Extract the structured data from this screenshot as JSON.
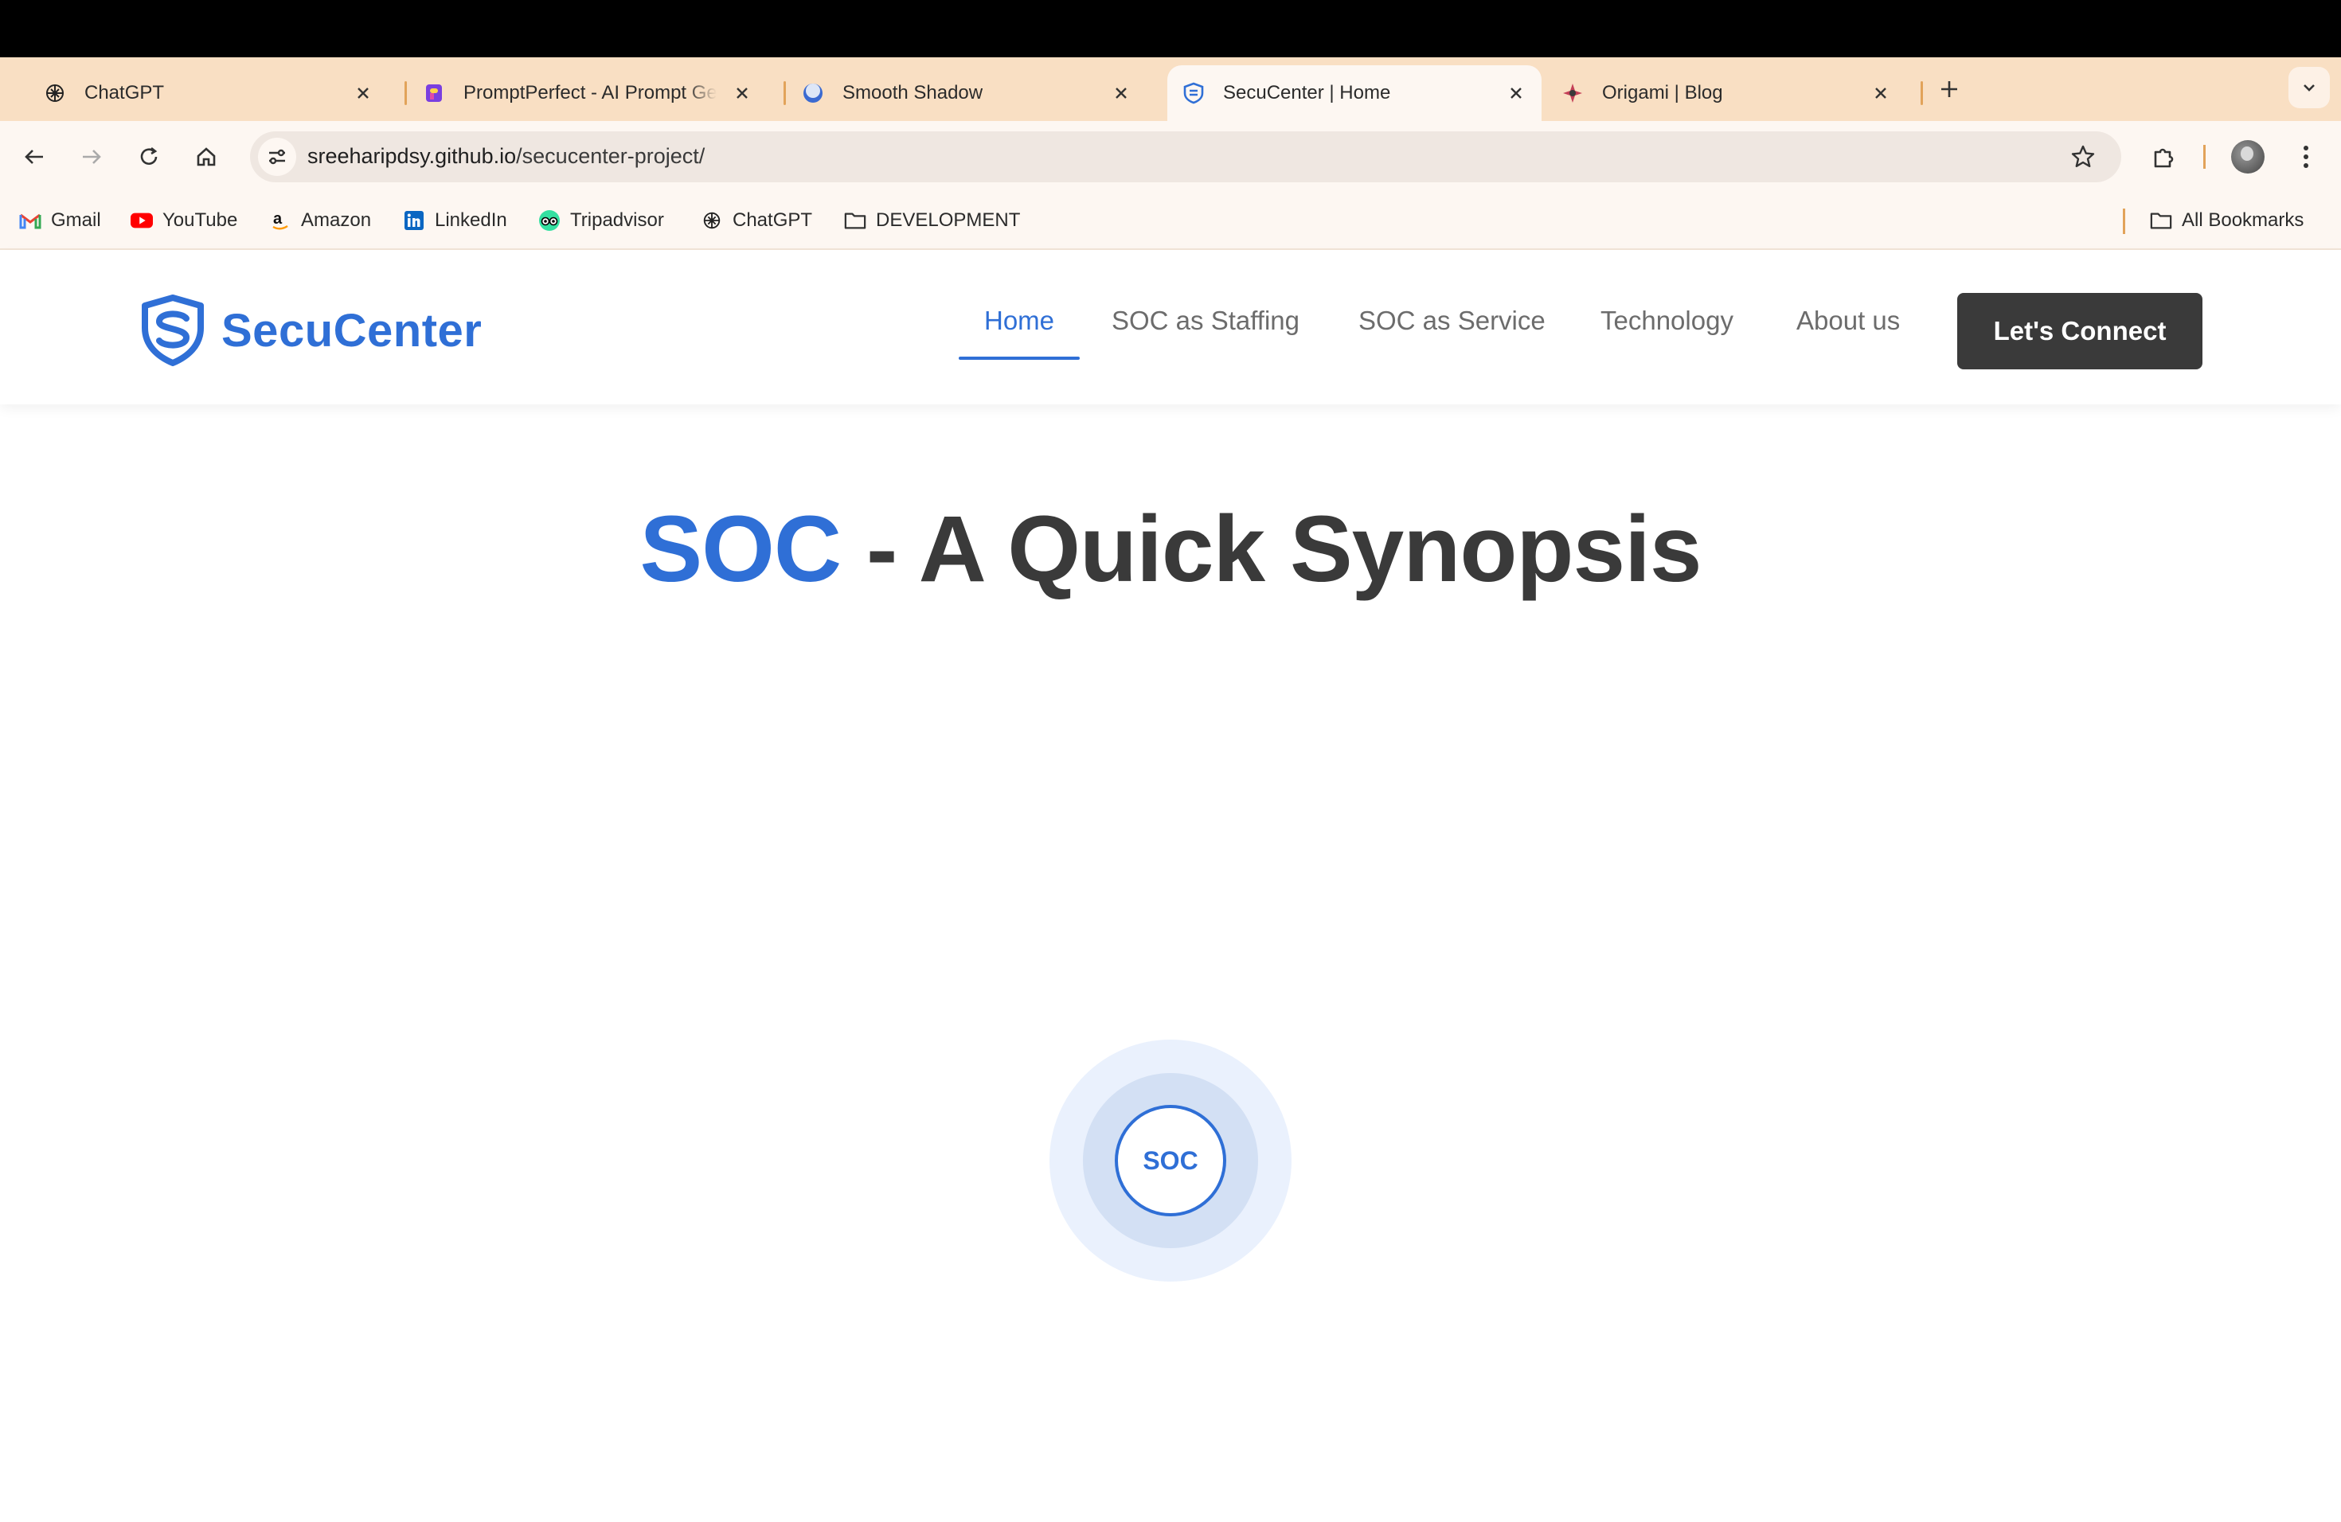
{
  "browser": {
    "tabs": [
      {
        "title": "ChatGPT",
        "icon": "chatgpt-icon",
        "active": false
      },
      {
        "title": "PromptPerfect - AI Prompt Generator",
        "icon": "promptperfect-icon",
        "active": false
      },
      {
        "title": "Smooth Shadow",
        "icon": "smooth-shadow-icon",
        "active": false
      },
      {
        "title": "SecuCenter | Home",
        "icon": "secucenter-shield-icon",
        "active": true
      },
      {
        "title": "Origami | Blog",
        "icon": "origami-icon",
        "active": false
      }
    ],
    "address": {
      "host": "sreeharipdsy.github.io",
      "path": "/secucenter-project/"
    },
    "bookmarks": [
      {
        "label": "Gmail",
        "icon": "gmail-icon"
      },
      {
        "label": "YouTube",
        "icon": "youtube-icon"
      },
      {
        "label": "Amazon",
        "icon": "amazon-icon"
      },
      {
        "label": "LinkedIn",
        "icon": "linkedin-icon"
      },
      {
        "label": "Tripadvisor",
        "icon": "tripadvisor-icon"
      },
      {
        "label": "ChatGPT",
        "icon": "chatgpt-icon"
      },
      {
        "label": "DEVELOPMENT",
        "icon": "folder-icon"
      }
    ],
    "all_bookmarks": "All Bookmarks"
  },
  "site": {
    "logo_text": "SecuCenter",
    "nav": [
      {
        "label": "Home",
        "active": true
      },
      {
        "label": "SOC as Staffing",
        "active": false
      },
      {
        "label": "SOC as Service",
        "active": false
      },
      {
        "label": "Technology",
        "active": false
      },
      {
        "label": "About us",
        "active": false
      }
    ],
    "cta": "Let's Connect"
  },
  "hero": {
    "accent": "SOC",
    "rest": " - A Quick Synopsis"
  },
  "diagram": {
    "center_label": "SOC"
  },
  "colors": {
    "accent": "#2f6fd6",
    "dark": "#3a3a3a",
    "tab_strip": "#f9dfc3"
  }
}
